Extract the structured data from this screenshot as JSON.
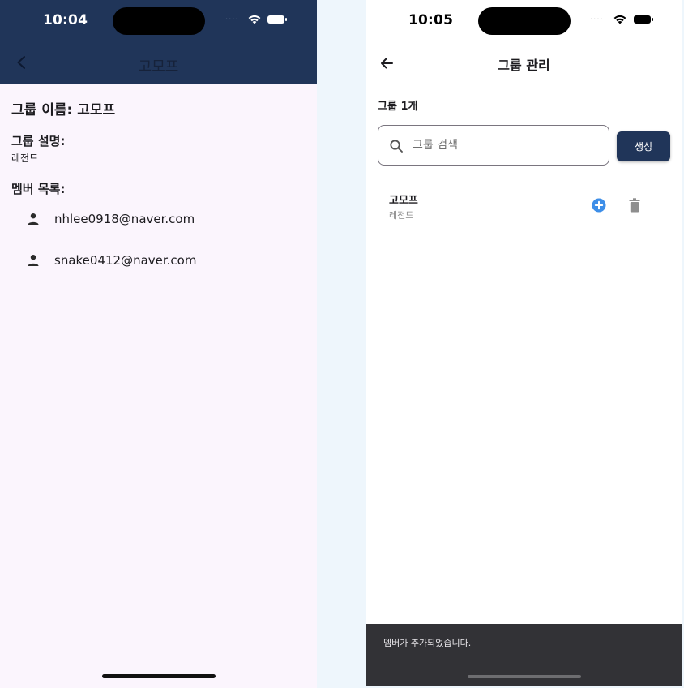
{
  "left_screen": {
    "status_bar": {
      "time": "10:04",
      "signal": "....",
      "wifi_icon": "wifi-icon",
      "battery_icon": "battery-icon"
    },
    "app_bar": {
      "back_icon": "chevron-left-icon",
      "title": "고모프"
    },
    "group_name_label": "그룹 이름: ",
    "group_name_value": "고모프",
    "description_label": "그룹 설명:",
    "description_value": "레전드",
    "members_label": "멤버 목록:",
    "members": [
      {
        "icon": "person-icon",
        "email": "nhlee0918@naver.com"
      },
      {
        "icon": "person-icon",
        "email": "snake0412@naver.com"
      }
    ]
  },
  "right_screen": {
    "status_bar": {
      "time": "10:05",
      "signal": "....",
      "wifi_icon": "wifi-icon",
      "battery_icon": "battery-icon"
    },
    "app_bar": {
      "back_icon": "arrow-left-icon",
      "title": "그룹 관리"
    },
    "group_count": "그룹 1개",
    "search": {
      "placeholder": "그룹 검색",
      "value": "",
      "icon": "search-icon"
    },
    "create_button_label": "생성",
    "groups": [
      {
        "name": "고모프",
        "description": "레전드",
        "actions": [
          "add-circle-icon",
          "trash-icon"
        ]
      }
    ],
    "snackbar_message": "멤버가 추가되었습니다."
  },
  "colors": {
    "app_bar": "#203559",
    "left_background": "#fbf5fd",
    "right_background": "#ffffff",
    "page_background": "#eef6fc",
    "add_icon": "#3d8ee8",
    "delete_icon": "#8e8e8e",
    "snackbar": "#323236"
  }
}
